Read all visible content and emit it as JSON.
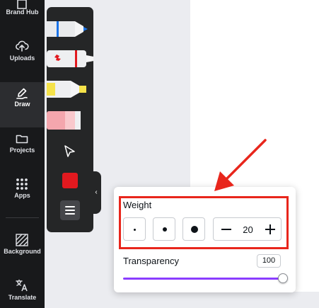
{
  "rail": {
    "items": [
      {
        "label": "Brand Hub",
        "icon": "brand-hub-icon"
      },
      {
        "label": "Uploads",
        "icon": "cloud-upload-icon"
      },
      {
        "label": "Draw",
        "icon": "draw-icon",
        "active": true
      },
      {
        "label": "Projects",
        "icon": "folder-icon"
      },
      {
        "label": "Apps",
        "icon": "apps-grid-icon"
      },
      {
        "label": "Background",
        "icon": "background-hatch-icon"
      },
      {
        "label": "Translate",
        "icon": "translate-icon"
      }
    ]
  },
  "draw_tools": {
    "tools": [
      {
        "name": "pen",
        "icon": "pen-icon",
        "accent": "#1a73e8"
      },
      {
        "name": "marker",
        "icon": "marker-icon",
        "accent": "#e2191f"
      },
      {
        "name": "highlighter",
        "icon": "highlighter-icon",
        "accent": "#f5e24a"
      },
      {
        "name": "eraser",
        "icon": "eraser-icon",
        "accent": "#f4a6ad"
      },
      {
        "name": "select",
        "icon": "cursor-arrow-icon"
      }
    ],
    "current_color": "#e2191f",
    "menu_icon": "hamburger-menu-icon"
  },
  "collapse_icon": "‹",
  "popover": {
    "weight_label": "Weight",
    "weight_presets": [
      "small",
      "medium",
      "large"
    ],
    "weight_value": "20",
    "minus_icon": "minus-icon",
    "plus_icon": "plus-icon",
    "transparency_label": "Transparency",
    "transparency_value": "100"
  },
  "annotation": {
    "color": "#e8261c"
  }
}
